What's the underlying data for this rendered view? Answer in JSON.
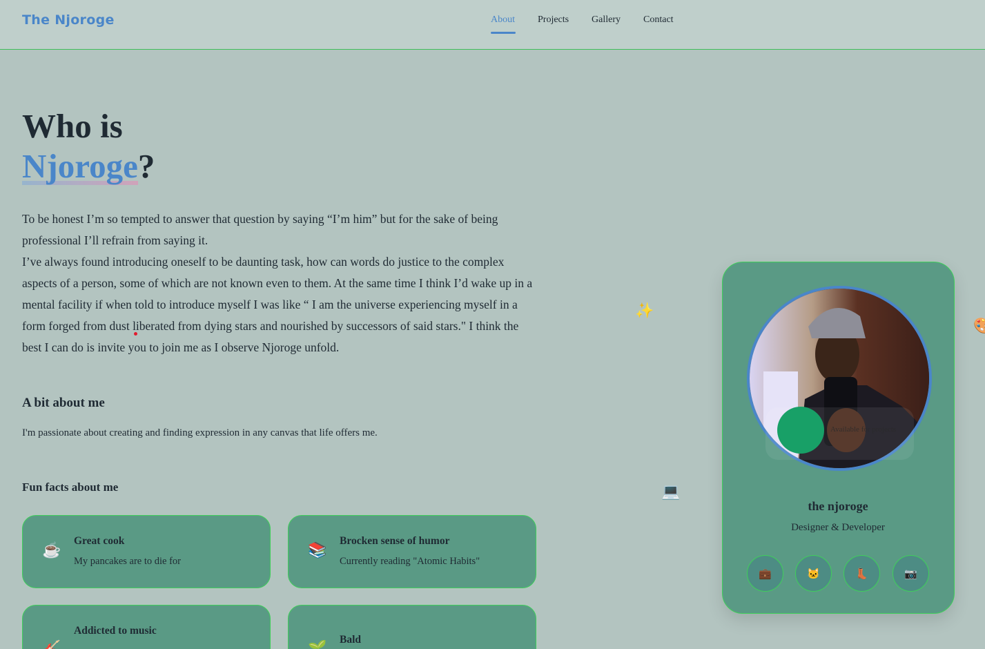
{
  "header": {
    "brand": "The Njoroge",
    "nav": [
      {
        "label": "About",
        "active": true
      },
      {
        "label": "Projects",
        "active": false
      },
      {
        "label": "Gallery",
        "active": false
      },
      {
        "label": "Contact",
        "active": false
      }
    ]
  },
  "hero": {
    "line1": "Who is",
    "name": "Njoroge",
    "qmark": "?"
  },
  "intro": {
    "p1": "To be honest I’m so tempted to answer that question by saying “I’m him” but for the sake of being professional I’ll refrain from saying it.",
    "p2": "I’ve always found introducing oneself to be daunting task, how can words do justice to the complex aspects of a person, some of which are not known even to them. At the same time I think I’d wake up in a mental facility if when told to introduce myself I was like “ I am the universe experiencing myself in a form forged from dust liberated from dying stars and nourished by successors of said stars.\" I think the best I can do is invite you to join me as I observe Njoroge unfold."
  },
  "about": {
    "heading": "A bit about me",
    "text": "I'm passionate about creating and finding expression in any canvas that life offers me."
  },
  "facts": {
    "heading": "Fun facts about me",
    "items": [
      {
        "icon": "coffee-icon",
        "glyph": "☕",
        "title": "Great cook",
        "desc": "My pancakes are to die for"
      },
      {
        "icon": "books-icon",
        "glyph": "📚",
        "title": "Brocken sense of humor",
        "desc": "Currently reading \"Atomic Habits\""
      },
      {
        "icon": "music-icon",
        "glyph": "🎸",
        "title": "Addicted to music",
        "desc": ""
      },
      {
        "icon": "sprout-icon",
        "glyph": "🌱",
        "title": "Bald",
        "desc": ""
      }
    ]
  },
  "decor": {
    "sparkle": "✨",
    "computer": "💻",
    "palette": "🎨"
  },
  "profile": {
    "name": "the njoroge",
    "role": "Designer & Developer",
    "availability": "Available for projects",
    "socials": [
      {
        "icon": "briefcase-icon",
        "glyph": "💼"
      },
      {
        "icon": "cat-icon",
        "glyph": "🐱"
      },
      {
        "icon": "boot-icon",
        "glyph": "👢"
      },
      {
        "icon": "camera-icon",
        "glyph": "📷"
      }
    ],
    "colors": {
      "card": "#5a9a85",
      "border": "#3fcf5a",
      "accent": "#4a86c9",
      "status": "#18a067"
    }
  }
}
